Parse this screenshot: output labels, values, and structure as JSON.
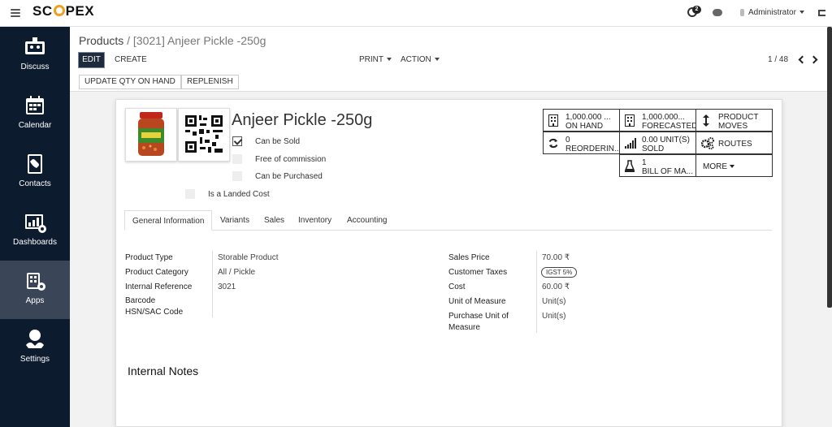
{
  "topbar": {
    "brand": "SCOPEX",
    "brand_pre": "SC",
    "brand_post": "PEX",
    "activity_badge": "2",
    "user_name": "Administrator"
  },
  "sidebar": {
    "items": [
      {
        "label": "Discuss",
        "icon": "discuss-icon"
      },
      {
        "label": "Calendar",
        "icon": "calendar-icon"
      },
      {
        "label": "Contacts",
        "icon": "contacts-icon"
      },
      {
        "label": "Dashboards",
        "icon": "dashboards-icon"
      },
      {
        "label": "Apps",
        "icon": "apps-icon"
      },
      {
        "label": "Settings",
        "icon": "settings-icon"
      }
    ],
    "active": "Apps"
  },
  "control_panel": {
    "breadcrumb_parent": "Products",
    "breadcrumb_sep": " / ",
    "breadcrumb_current": "[3021] Anjeer Pickle -250g",
    "edit_label": "EDIT",
    "create_label": "CREATE",
    "print_label": "PRINT",
    "action_label": "ACTION",
    "pager": "1 / 48",
    "update_qty_label": "UPDATE QTY ON HAND",
    "replenish_label": "REPLENISH"
  },
  "product": {
    "name": "Anjeer Pickle -250g",
    "can_be_sold_label": "Can be Sold",
    "can_be_sold": true,
    "free_of_commission_label": "Free of commission",
    "free_of_commission": false,
    "can_be_purchased_label": "Can be Purchased",
    "can_be_purchased": false,
    "is_landed_cost_label": "Is a Landed Cost",
    "is_landed_cost": false
  },
  "smart_buttons": {
    "on_hand_value": "1,000.000 ...",
    "on_hand_label": "ON HAND",
    "forecasted_value": "1,000.000...",
    "forecasted_label": "FORECASTED",
    "product_moves_1": "PRODUCT",
    "product_moves_2": "MOVES",
    "reordering_value": "0",
    "reordering_label": "REORDERIN...",
    "sold_value": "0.00 UNIT(S)",
    "sold_label": "SOLD",
    "routes_label": "ROUTES",
    "bom_value": "1",
    "bom_label": "BILL OF MA...",
    "more_label": "MORE"
  },
  "tabs": [
    "General Information",
    "Variants",
    "Sales",
    "Inventory",
    "Accounting"
  ],
  "general_info": {
    "left": {
      "product_type_label": "Product Type",
      "product_type": "Storable Product",
      "product_category_label": "Product Category",
      "product_category": "All / Pickle",
      "internal_reference_label": "Internal Reference",
      "internal_reference": "3021",
      "barcode_label": "Barcode",
      "hsn_label": "HSN/SAC Code"
    },
    "right": {
      "sales_price_label": "Sales Price",
      "sales_price": "70.00 ₹",
      "customer_taxes_label": "Customer Taxes",
      "customer_taxes": "IGST 5%",
      "cost_label": "Cost",
      "cost": "60.00 ₹",
      "uom_label": "Unit of Measure",
      "uom": "Unit(s)",
      "purchase_uom_label_1": "Purchase Unit of",
      "purchase_uom_label_2": "Measure",
      "purchase_uom": "Unit(s)"
    }
  },
  "internal_notes_title": "Internal Notes",
  "colors": {
    "sidebar_bg": "#0d1b2e",
    "sidebar_active": "#3a4657",
    "brand_accent": "#f0a020",
    "edit_btn": "#1f2a3c"
  }
}
